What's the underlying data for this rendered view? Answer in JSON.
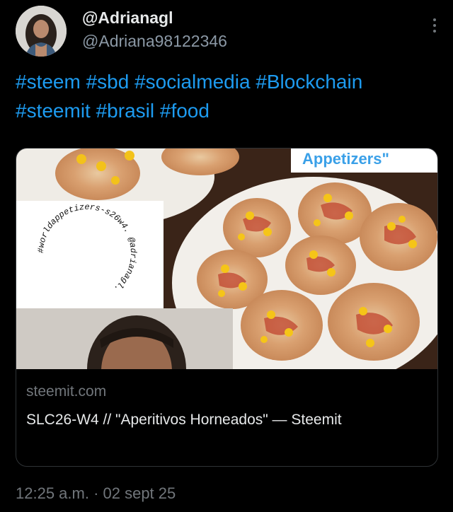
{
  "author": {
    "display_name": "@Adrianagl",
    "handle": "@Adriana98122346"
  },
  "tweet": {
    "hashtags_line1": [
      "#steem",
      "#sbd",
      "#socialmedia",
      "#Blockchain"
    ],
    "hashtags_line2": [
      "#steemit",
      "#brasil",
      "#food"
    ]
  },
  "card": {
    "image": {
      "banner_text": "Appetizers\"",
      "circle_text": "#worldappetizers-s26w4. @adrianagl."
    },
    "domain": "steemit.com",
    "title": "SLC26-W4 // \"Aperitivos Horneados\" — Steemit"
  },
  "timestamp": "12:25 a.m. · 02 sept 25",
  "icons": {
    "more": "more-vertical-icon"
  },
  "colors": {
    "background": "#000000",
    "link": "#1d9bf0",
    "primary_text": "#e7e9ea",
    "secondary_text": "#71767b"
  }
}
